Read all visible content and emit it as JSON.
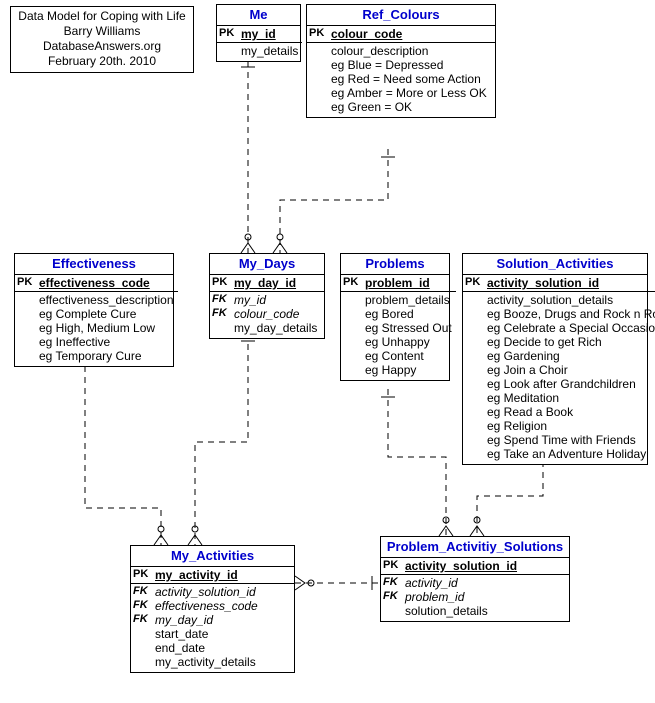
{
  "caption": {
    "title": "Data Model for Coping with Life",
    "author": "Barry Williams",
    "source": "DatabaseAnswers.org",
    "date": "February 20th. 2010"
  },
  "entities": {
    "me": {
      "name": "Me",
      "rows": [
        {
          "key": "PK",
          "field": "my_id"
        },
        {
          "key": "",
          "field": "my_details"
        }
      ]
    },
    "ref_colours": {
      "name": "Ref_Colours",
      "rows": [
        {
          "key": "PK",
          "field": "colour_code"
        },
        {
          "key": "",
          "field": "colour_description"
        },
        {
          "key": "",
          "field": "eg Blue = Depressed"
        },
        {
          "key": "",
          "field": "eg Red = Need some Action"
        },
        {
          "key": "",
          "field": "eg Amber = More or Less OK"
        },
        {
          "key": "",
          "field": "eg Green = OK"
        }
      ]
    },
    "effectiveness": {
      "name": "Effectiveness",
      "rows": [
        {
          "key": "PK",
          "field": "effectiveness_code"
        },
        {
          "key": "",
          "field": "effectiveness_description"
        },
        {
          "key": "",
          "field": "eg Complete Cure"
        },
        {
          "key": "",
          "field": "eg High, Medium Low"
        },
        {
          "key": "",
          "field": "eg Ineffective"
        },
        {
          "key": "",
          "field": "eg Temporary Cure"
        }
      ]
    },
    "my_days": {
      "name": "My_Days",
      "rows": [
        {
          "key": "PK",
          "field": "my_day_id"
        },
        {
          "key": "FK",
          "field": "my_id"
        },
        {
          "key": "FK",
          "field": "colour_code"
        },
        {
          "key": "",
          "field": "my_day_details"
        }
      ]
    },
    "problems": {
      "name": "Problems",
      "rows": [
        {
          "key": "PK",
          "field": "problem_id"
        },
        {
          "key": "",
          "field": "problem_details"
        },
        {
          "key": "",
          "field": "eg Bored"
        },
        {
          "key": "",
          "field": "eg Stressed Out"
        },
        {
          "key": "",
          "field": "eg Unhappy"
        },
        {
          "key": "",
          "field": "eg Content"
        },
        {
          "key": "",
          "field": "eg Happy"
        }
      ]
    },
    "solution_activities": {
      "name": "Solution_Activities",
      "rows": [
        {
          "key": "PK",
          "field": "activity_solution_id"
        },
        {
          "key": "",
          "field": "activity_solution_details"
        },
        {
          "key": "",
          "field": "eg Booze, Drugs and Rock n Roll"
        },
        {
          "key": "",
          "field": "eg Celebrate a Special Occasion"
        },
        {
          "key": "",
          "field": "eg Decide to get Rich"
        },
        {
          "key": "",
          "field": "eg Gardening"
        },
        {
          "key": "",
          "field": "eg Join a Choir"
        },
        {
          "key": "",
          "field": "eg Look after Grandchildren"
        },
        {
          "key": "",
          "field": "eg Meditation"
        },
        {
          "key": "",
          "field": "eg Read a Book"
        },
        {
          "key": "",
          "field": "eg Religion"
        },
        {
          "key": "",
          "field": "eg Spend Time with Friends"
        },
        {
          "key": "",
          "field": "eg Take an Adventure Holiday"
        }
      ]
    },
    "my_activities": {
      "name": "My_Activities",
      "rows": [
        {
          "key": "PK",
          "field": "my_activity_id"
        },
        {
          "key": "FK",
          "field": "activity_solution_id"
        },
        {
          "key": "FK",
          "field": "effectiveness_code"
        },
        {
          "key": "FK",
          "field": "my_day_id"
        },
        {
          "key": "",
          "field": "start_date"
        },
        {
          "key": "",
          "field": "end_date"
        },
        {
          "key": "",
          "field": "my_activity_details"
        }
      ]
    },
    "problem_activity_solutions": {
      "name": "Problem_Activitiy_Solutions",
      "rows": [
        {
          "key": "PK",
          "field": "activity_solution_id"
        },
        {
          "key": "FK",
          "field": "activity_id"
        },
        {
          "key": "FK",
          "field": "problem_id"
        },
        {
          "key": "",
          "field": "solution_details"
        }
      ]
    }
  },
  "relationships": [
    {
      "from": "me",
      "to": "my_days",
      "type": "one-to-many"
    },
    {
      "from": "ref_colours",
      "to": "my_days",
      "type": "one-to-many"
    },
    {
      "from": "effectiveness",
      "to": "my_activities",
      "type": "one-to-many"
    },
    {
      "from": "my_days",
      "to": "my_activities",
      "type": "one-to-many"
    },
    {
      "from": "problems",
      "to": "problem_activity_solutions",
      "type": "one-to-many"
    },
    {
      "from": "solution_activities",
      "to": "problem_activity_solutions",
      "type": "one-to-many"
    },
    {
      "from": "problem_activity_solutions",
      "to": "my_activities",
      "type": "one-to-many"
    }
  ]
}
